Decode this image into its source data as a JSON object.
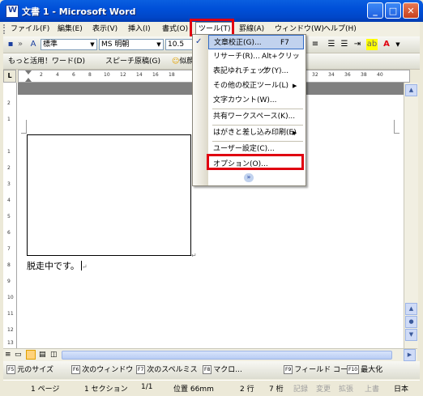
{
  "window": {
    "title": "文書 1 - Microsoft Word",
    "controls": [
      "_",
      "□",
      "✕"
    ]
  },
  "menubar": [
    "ファイル(F)",
    "編集(E)",
    "表示(V)",
    "挿入(I)",
    "書式(O)",
    "ツール(T)",
    "罫線(A)",
    "ウィンドウ(W)",
    "ヘルプ(H)"
  ],
  "toolbar1": {
    "style": "標準",
    "font": "MS 明朝",
    "size": "10.5"
  },
  "toolbar2": {
    "item1": "もっと活用！ワード(D)",
    "item2": "スピーチ原稿(G)",
    "item3": "似顔"
  },
  "ruler": {
    "numbers": [
      "2",
      "4",
      "6",
      "8",
      "10",
      "12",
      "14",
      "16",
      "18",
      "32",
      "34",
      "36",
      "38",
      "40"
    ]
  },
  "vruler_numbers": [
    "2",
    "1",
    "1",
    "2",
    "3",
    "4",
    "5",
    "6",
    "7",
    "8",
    "9",
    "10",
    "11",
    "12",
    "13"
  ],
  "tools_menu": {
    "items": [
      {
        "label": "文章校正(G)...",
        "shortcut": "F7"
      },
      {
        "label": "リサーチ(R)...",
        "shortcut": "Alt+クリック"
      },
      {
        "label": "表記ゆれチェック(Y)...",
        "shortcut": ""
      },
      {
        "label": "その他の校正ツール(L)",
        "shortcut": "▶"
      },
      {
        "label": "文字カウント(W)...",
        "shortcut": ""
      },
      {
        "label": "共有ワークスペース(K)...",
        "shortcut": ""
      },
      {
        "label": "はがきと差し込み印刷(E)",
        "shortcut": "▶"
      },
      {
        "label": "ユーザー設定(C)...",
        "shortcut": ""
      },
      {
        "label": "オプション(O)...",
        "shortcut": ""
      }
    ],
    "expand": "»"
  },
  "document": {
    "text": "脱走中です。"
  },
  "function_keys": [
    {
      "key": "F5",
      "label": "元のサイズ"
    },
    {
      "key": "F6",
      "label": "次のウィンドウ"
    },
    {
      "key": "F7",
      "label": "次のスペルミス"
    },
    {
      "key": "F8",
      "label": "マクロ..."
    },
    {
      "key": "F9",
      "label": "フィールド コー.."
    },
    {
      "key": "F10",
      "label": "最大化"
    }
  ],
  "status": {
    "page": "1 ページ",
    "section": "1 セクション",
    "pages": "1/1",
    "position": "位置 66mm",
    "line": "2 行",
    "column": "7 桁",
    "rec": "記録",
    "trk": "変更",
    "ext": "拡張",
    "ovr": "上書",
    "lang": "日本"
  },
  "colors": {
    "title_bar": "#0054e3",
    "highlight": "#e00010",
    "menu_hover": "#c1d2ee"
  }
}
